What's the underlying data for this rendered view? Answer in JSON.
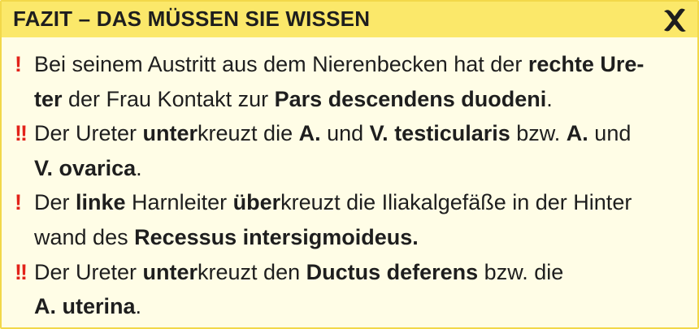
{
  "header": {
    "title": "FAZIT – DAS MÜSSEN SIE WISSEN"
  },
  "items": [
    {
      "marker": "!",
      "lines": [
        [
          {
            "t": "Bei seinem Austritt aus dem Nierenbecken hat der ",
            "b": false
          },
          {
            "t": "rechte Ure-",
            "b": true
          }
        ],
        [
          {
            "t": "ter",
            "b": true
          },
          {
            "t": " der Frau Kontakt zur ",
            "b": false
          },
          {
            "t": "Pars descendens duodeni",
            "b": true
          },
          {
            "t": ".",
            "b": false
          }
        ]
      ]
    },
    {
      "marker": "!!",
      "lines": [
        [
          {
            "t": "Der Ureter ",
            "b": false
          },
          {
            "t": "unter",
            "b": true
          },
          {
            "t": "kreuzt die ",
            "b": false
          },
          {
            "t": "A.",
            "b": true
          },
          {
            "t": " und ",
            "b": false
          },
          {
            "t": "V. testicularis",
            "b": true
          },
          {
            "t": " bzw. ",
            "b": false
          },
          {
            "t": "A.",
            "b": true
          },
          {
            "t": " und",
            "b": false
          }
        ],
        [
          {
            "t": "V. ovarica",
            "b": true
          },
          {
            "t": ".",
            "b": false
          }
        ]
      ]
    },
    {
      "marker": "!",
      "lines": [
        [
          {
            "t": "Der ",
            "b": false
          },
          {
            "t": "linke",
            "b": true
          },
          {
            "t": " Harnleiter ",
            "b": false
          },
          {
            "t": "über",
            "b": true
          },
          {
            "t": "kreuzt die Iliakalgefäße in der Hinter",
            "b": false
          }
        ],
        [
          {
            "t": "wand des ",
            "b": false
          },
          {
            "t": "Recessus intersigmoideus.",
            "b": true
          }
        ]
      ]
    },
    {
      "marker": "!!",
      "lines": [
        [
          {
            "t": "Der Ureter ",
            "b": false
          },
          {
            "t": "unter",
            "b": true
          },
          {
            "t": "kreuzt den ",
            "b": false
          },
          {
            "t": "Ductus deferens",
            "b": true
          },
          {
            "t": " bzw. die",
            "b": false
          }
        ],
        [
          {
            "t": "A. uterina",
            "b": true
          },
          {
            "t": ".",
            "b": false
          }
        ]
      ]
    }
  ],
  "colors": {
    "header_bg": "#fbe86a",
    "body_bg": "#fffde6",
    "border": "#f2d84a",
    "marker": "#e2231a",
    "text": "#1e1e1e"
  },
  "icons": {
    "close": "close-icon"
  }
}
